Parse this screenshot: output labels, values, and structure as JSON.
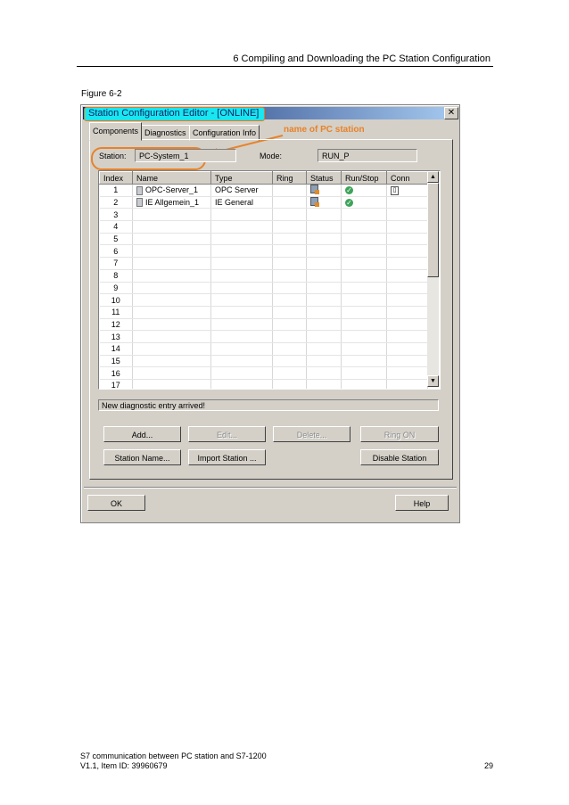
{
  "page": {
    "header": "6 Compiling and Downloading the PC Station Configuration",
    "figure_label": "Figure 6-2",
    "footer_line1": "S7 communication between PC station and S7-1200",
    "footer_line2": "V1.1, Item ID: 39960679",
    "page_number": "29"
  },
  "dialog": {
    "title": "Station Configuration Editor - [ONLINE]",
    "close_glyph": "✕",
    "tabs": [
      "Components",
      "Diagnostics",
      "Configuration Info"
    ],
    "annotation": "name of PC station",
    "station_label": "Station:",
    "station_value": "PC-System_1",
    "mode_label": "Mode:",
    "mode_value": "RUN_P",
    "columns": [
      "Index",
      "Name",
      "Type",
      "Ring",
      "Status",
      "Run/Stop",
      "Conn"
    ],
    "rows": [
      {
        "index": "1",
        "name": "OPC-Server_1",
        "type": "OPC Server",
        "ring": "",
        "status": "status-icon",
        "runstop": "✓",
        "conn": "▯"
      },
      {
        "index": "2",
        "name": "IE Allgemein_1",
        "type": "IE General",
        "ring": "",
        "status": "status-icon",
        "runstop": "✓",
        "conn": ""
      },
      {
        "index": "3"
      },
      {
        "index": "4"
      },
      {
        "index": "5"
      },
      {
        "index": "6"
      },
      {
        "index": "7"
      },
      {
        "index": "8"
      },
      {
        "index": "9"
      },
      {
        "index": "10"
      },
      {
        "index": "11"
      },
      {
        "index": "12"
      },
      {
        "index": "13"
      },
      {
        "index": "14"
      },
      {
        "index": "15"
      },
      {
        "index": "16"
      },
      {
        "index": "17"
      }
    ],
    "status_message": "New diagnostic entry arrived!",
    "buttons": {
      "add": "Add...",
      "edit": "Edit...",
      "delete": "Delete...",
      "ring_on": "Ring ON",
      "station_name": "Station Name...",
      "import_station": "Import Station ...",
      "disable_station": "Disable Station",
      "ok": "OK",
      "help": "Help"
    },
    "colors": {
      "dialog_bg": "#d4d0c8",
      "annotation": "#e8822a",
      "title_highlight": "#19e6ee"
    }
  }
}
